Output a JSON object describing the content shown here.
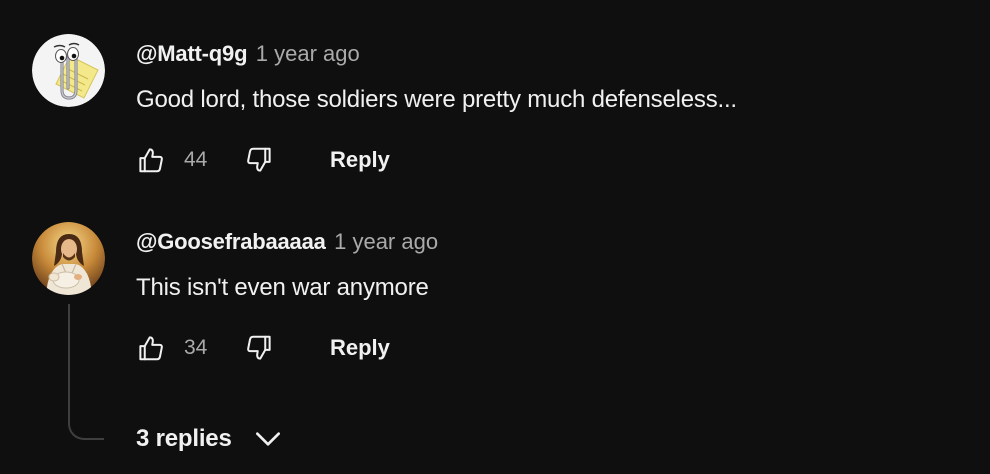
{
  "comments": [
    {
      "author": "@Matt-q9g",
      "time": "1 year ago",
      "text": "Good lord, those soldiers were pretty much defenseless...",
      "likes": "44",
      "reply_label": "Reply",
      "avatar_icon": "paperclip-assistant-icon"
    },
    {
      "author": "@Goosefrabaaaaa",
      "time": "1 year ago",
      "text": "This isn't even war anymore",
      "likes": "34",
      "reply_label": "Reply",
      "avatar_icon": "painting-portrait-icon"
    }
  ],
  "replies_toggle": {
    "label": "3 replies"
  },
  "colors": {
    "background": "#0f0f0f",
    "text_primary": "#f1f1f1",
    "text_secondary": "#aaaaaa",
    "thread_line": "#3f3f3f"
  }
}
